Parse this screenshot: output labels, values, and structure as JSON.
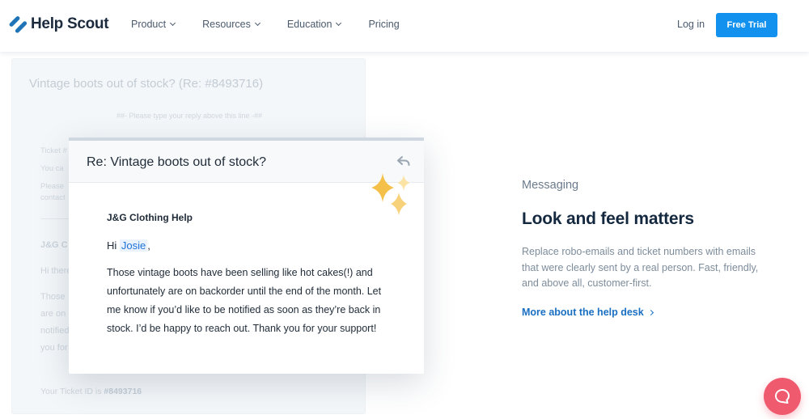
{
  "nav": {
    "logo_text": "Help Scout",
    "menu": [
      {
        "label": "Product",
        "has_dropdown": true
      },
      {
        "label": "Resources",
        "has_dropdown": true
      },
      {
        "label": "Education",
        "has_dropdown": true
      },
      {
        "label": "Pricing",
        "has_dropdown": false
      }
    ],
    "login_label": "Log in",
    "trial_label": "Free Trial"
  },
  "background_ticket": {
    "subject": "Vintage boots out of stock? (Re: #8493716)",
    "reply_line": "##- Please type your reply above this line -##",
    "ticket_lines": [
      "Ticket #",
      "You ca",
      "Please",
      "contact"
    ],
    "sender": "J&G C",
    "greeting": "Hi there",
    "body_lines": [
      "Those",
      "are on",
      "notified",
      "you for"
    ],
    "footer_prefix": "Your Ticket ID is",
    "footer_id": "#8493716"
  },
  "email": {
    "subject": "Re: Vintage boots out of stock?",
    "sender": "J&G Clothing Help",
    "greeting_prefix": "Hi",
    "greeting_name": "Josie",
    "greeting_suffix": ",",
    "body": "Those vintage boots have been selling like hot cakes(!) and unfortunately are on backorder until the end of the month. Let me know if you’d like to be notified as soon as they’re back in stock. I’d be happy to reach out. Thank you for your support!"
  },
  "section": {
    "label": "Messaging",
    "title": "Look and feel matters",
    "description": "Replace robo-emails and ticket numbers with emails that were clearly sent by a real person. Fast, friendly, and above all, customer-first.",
    "link": "More about the help desk"
  },
  "icons": {
    "logo": "help-scout-logo-icon",
    "reply": "reply-arrow-icon",
    "sparkles": "sparkles-icon",
    "beacon": "chat-beacon-icon"
  },
  "colors": {
    "brand_blue": "#1292ee",
    "link_blue": "#1a6fc2",
    "beacon_red": "#ef5a6f",
    "sparkle_gold": "#f5c04a"
  }
}
